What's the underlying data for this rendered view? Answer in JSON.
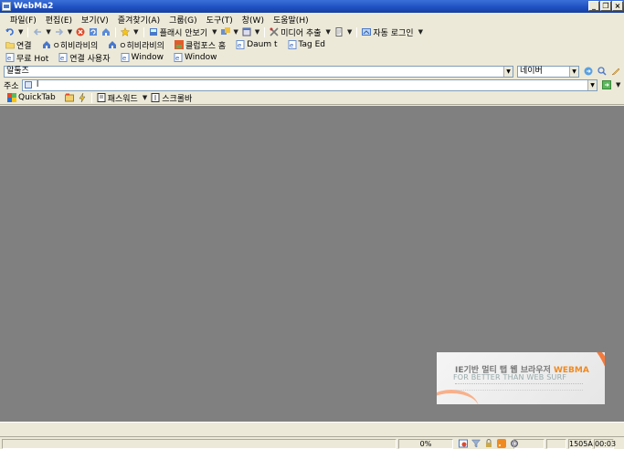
{
  "window": {
    "title": "WebMa2"
  },
  "menu": [
    "파일(F)",
    "편집(E)",
    "보기(V)",
    "즐겨찾기(A)",
    "그룹(G)",
    "도구(T)",
    "창(W)",
    "도움말(H)"
  ],
  "toolbar1": {
    "flash_label": "플래시 안보기",
    "media_label": "미디어 추출",
    "autologin_label": "자동 로그인"
  },
  "links1": [
    "연결",
    "ㅇ히비라비의",
    "ㅇ히비라비의",
    "클럽포스 홈",
    "Daum t",
    "Tag Ed"
  ],
  "links2": [
    "무료 Hot",
    "연결 사용자",
    "Window",
    "Window"
  ],
  "search": {
    "value": "알툴즈",
    "engine": "네이버"
  },
  "address": {
    "label": "주소",
    "value": "l"
  },
  "quicktab": {
    "label": "QuickTab",
    "password_label": "패스워드",
    "scrollbar_label": "스크롤바"
  },
  "banner": {
    "line1": "IE기반 멀티 탭 웹 브라우저",
    "brand": "WEBMA",
    "line2": "FOR BETTER THAN WEB SURF"
  },
  "status": {
    "progress": "0%",
    "code": "1505A",
    "time": "00:03"
  },
  "colors": {
    "content_bg": "#808080",
    "accent": "#f08a20"
  }
}
